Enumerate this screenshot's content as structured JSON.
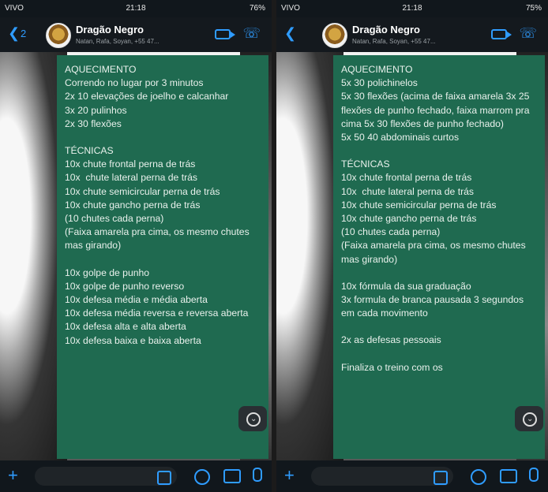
{
  "status": {
    "carrier": "VIVO",
    "time": "21:18",
    "battery_left": "76%",
    "battery_right": "75%"
  },
  "header": {
    "back_count": "2",
    "title": "Dragão Negro",
    "subtitle": "Natan, Rafa, Soyan, +55 47..."
  },
  "left_message": {
    "lines": [
      "AQUECIMENTO",
      "Correndo no lugar por 3 minutos",
      "2x 10 elevações de joelho e calcanhar",
      "3x 20 pulinhos",
      "2x 30 flexões",
      "",
      "TÉCNICAS",
      "10x chute frontal perna de trás",
      "10x  chute lateral perna de trás",
      "10x chute semicircular perna de trás",
      "10x chute gancho perna de trás",
      "(10 chutes cada perna)",
      "(Faixa amarela pra cima, os mesmo chutes mas girando)",
      "",
      "10x golpe de punho",
      "10x golpe de punho reverso",
      "10x defesa média e média aberta",
      "10x defesa média reversa e reversa aberta",
      "10x defesa alta e alta aberta",
      "10x defesa baixa e baixa aberta"
    ]
  },
  "right_message": {
    "lines": [
      "AQUECIMENTO",
      "5x 30 polichinelos",
      "5x 30 flexões (acima de faixa amarela 3x 25 flexões de punho fechado, faixa marrom pra cima 5x 30 flexões de punho fechado)",
      "5x 50 40 abdominais curtos",
      "",
      "TÉCNICAS",
      "10x chute frontal perna de trás",
      "10x  chute lateral perna de trás",
      "10x chute semicircular perna de trás",
      "10x chute gancho perna de trás",
      "(10 chutes cada perna)",
      "(Faixa amarela pra cima, os mesmo chutes mas girando)",
      "",
      "10x fórmula da sua graduação",
      "3x formula de branca pausada 3 segundos em cada movimento",
      "",
      "2x as defesas pessoais",
      "",
      "Finaliza o treino com os"
    ]
  },
  "colors": {
    "accent": "#2f9cff",
    "bubble": "#1f6a50"
  },
  "icons": [
    "back-icon",
    "video-call-icon",
    "phone-call-icon",
    "scroll-down-icon",
    "plus-icon",
    "sticker-icon",
    "money-icon",
    "camera-icon",
    "mic-icon"
  ]
}
